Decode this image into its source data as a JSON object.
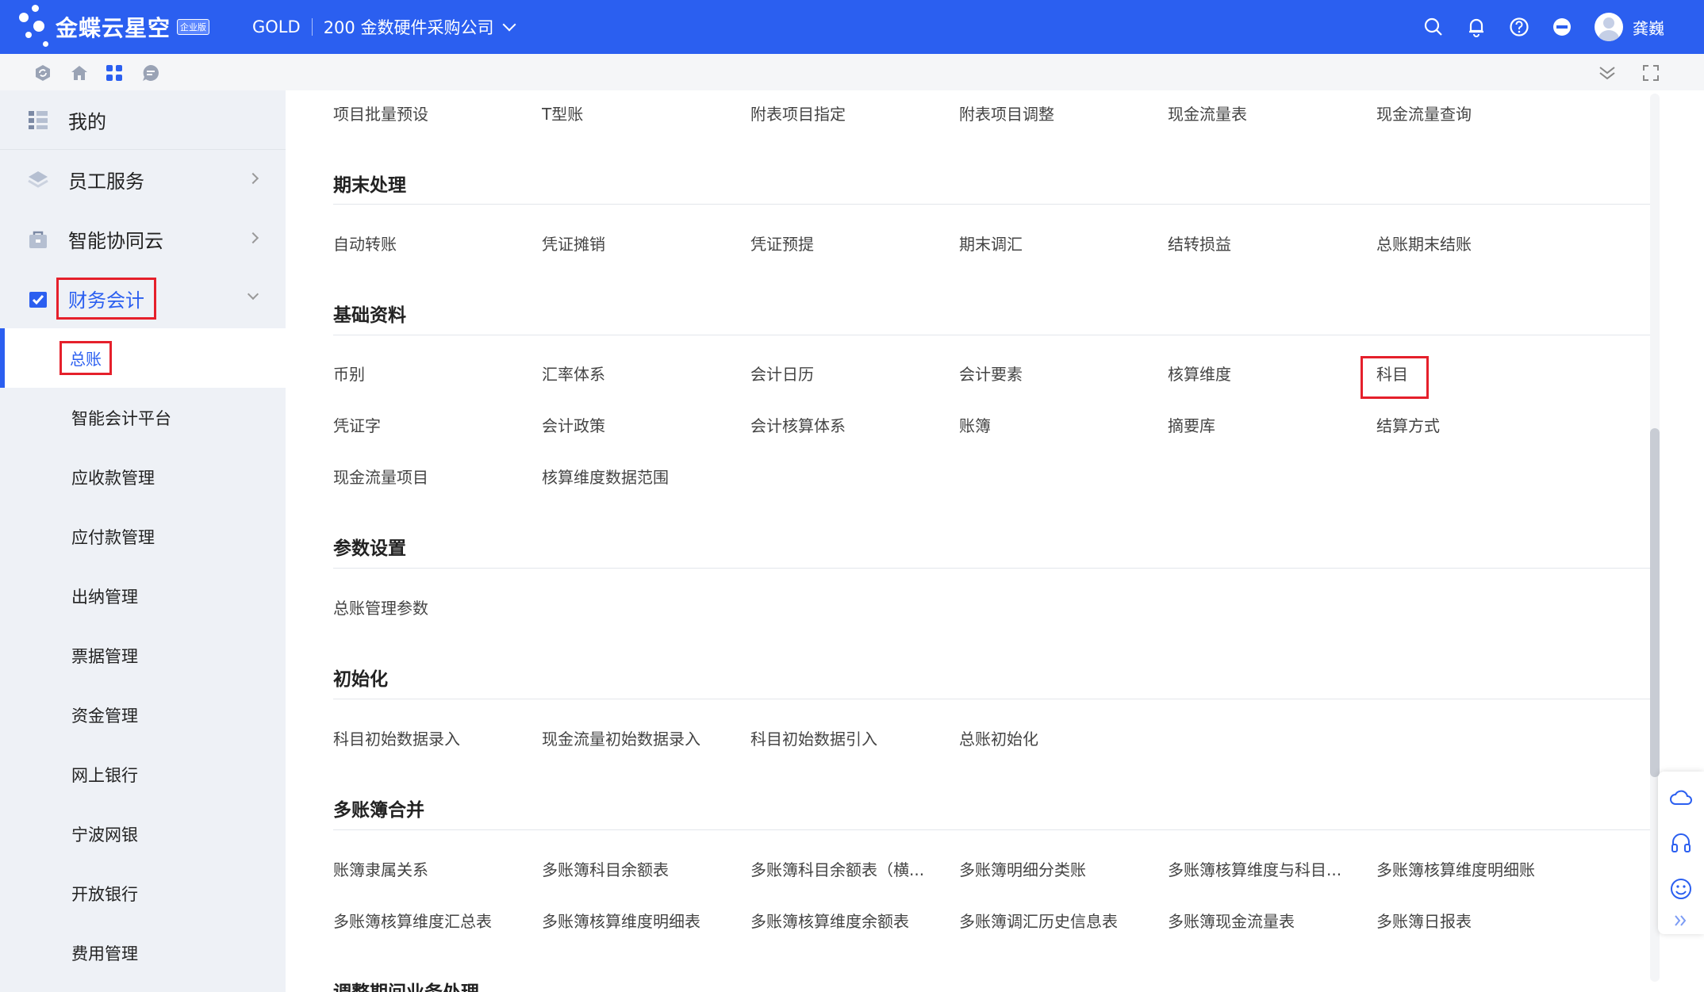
{
  "topbar": {
    "brand": "金蝶云星空",
    "edition": "企业版",
    "env": "GOLD",
    "company": "200 金数硬件采购公司",
    "username": "龚巍",
    "icons": [
      "search-icon",
      "bell-icon",
      "help-icon",
      "minus-circle-icon",
      "avatar"
    ]
  },
  "toolbar": {
    "icons": [
      "refresh-icon",
      "home-icon",
      "apps-icon",
      "chat-icon",
      "collapse-down-icon",
      "fullscreen-icon"
    ]
  },
  "sidebar": {
    "groups": [
      {
        "label": "我的",
        "icon": "list-icon"
      },
      {
        "label": "员工服务",
        "icon": "layers-icon"
      },
      {
        "label": "智能协同云",
        "icon": "bag-icon"
      },
      {
        "label": "财务会计",
        "icon": "check-box-icon"
      }
    ],
    "subitems": [
      "总账",
      "智能会计平台",
      "应收款管理",
      "应付款管理",
      "出纳管理",
      "票据管理",
      "资金管理",
      "网上银行",
      "宁波网银",
      "开放银行",
      "费用管理"
    ]
  },
  "main": {
    "top_row": [
      "项目批量预设",
      "T型账",
      "附表项目指定",
      "附表项目调整",
      "现金流量表",
      "现金流量查询"
    ],
    "sections": [
      {
        "title": "期末处理",
        "rows": [
          [
            "自动转账",
            "凭证摊销",
            "凭证预提",
            "期末调汇",
            "结转损益",
            "总账期末结账"
          ]
        ]
      },
      {
        "title": "基础资料",
        "rows": [
          [
            "币别",
            "汇率体系",
            "会计日历",
            "会计要素",
            "核算维度",
            "科目"
          ],
          [
            "凭证字",
            "会计政策",
            "会计核算体系",
            "账簿",
            "摘要库",
            "结算方式"
          ],
          [
            "现金流量项目",
            "核算维度数据范围"
          ]
        ]
      },
      {
        "title": "参数设置",
        "rows": [
          [
            "总账管理参数"
          ]
        ]
      },
      {
        "title": "初始化",
        "rows": [
          [
            "科目初始数据录入",
            "现金流量初始数据录入",
            "科目初始数据引入",
            "总账初始化"
          ]
        ]
      },
      {
        "title": "多账簿合并",
        "rows": [
          [
            "账簿隶属关系",
            "多账簿科目余额表",
            "多账簿科目余额表（横...",
            "多账簿明细分类账",
            "多账簿核算维度与科目...",
            "多账簿核算维度明细账"
          ],
          [
            "多账簿核算维度汇总表",
            "多账簿核算维度明细表",
            "多账簿核算维度余额表",
            "多账簿调汇历史信息表",
            "多账簿现金流量表",
            "多账簿日报表"
          ]
        ]
      },
      {
        "title": "调整期间业务处理",
        "rows": []
      }
    ]
  },
  "float_panel": {
    "icons": [
      "cloud-icon",
      "headset-icon",
      "smile-icon",
      "double-chevron-right-icon"
    ]
  },
  "colors": {
    "primary": "#2b5ff0",
    "highlight": "#e5202b",
    "sidebar_bg": "#eef1f6"
  }
}
